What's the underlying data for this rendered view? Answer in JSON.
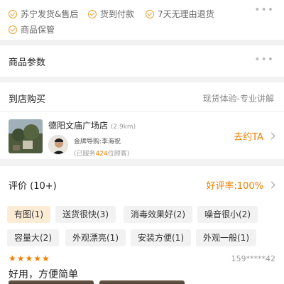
{
  "services": {
    "items": [
      "苏宁发货&售后",
      "货到付款",
      "7天无理由退货",
      "商品保管"
    ],
    "more": "•••"
  },
  "params": {
    "title": "商品参数",
    "more": "•••"
  },
  "store_purchase": {
    "title": "到店购买",
    "subtitle": "现货体验-专业讲解",
    "store_name": "德阳文庙广场店",
    "distance": "(2.9km)",
    "guide": "金牌导购:李海祝",
    "served_prefix": "(已服务",
    "served_count": "424",
    "served_suffix": "位顾客)",
    "visit_label": "去约TA"
  },
  "reviews": {
    "title": "评价 (10+)",
    "good_rate": "好评率:100%",
    "tags": [
      "有图(1)",
      "送货很快(3)",
      "消毒效果好(2)",
      "噪音很小(2)",
      "容量大(2)",
      "外观漂亮(1)",
      "安装方便(1)",
      "外观一般(1)"
    ],
    "active_tag": 0,
    "rating": 5,
    "rating_stars": "★★★★★",
    "reviewer": "159*****42",
    "review_text": "好用，方便简单"
  },
  "colors": {
    "accent": "#f08000",
    "check": "#f0a030",
    "active_tag_bg": "#fcecd6"
  }
}
